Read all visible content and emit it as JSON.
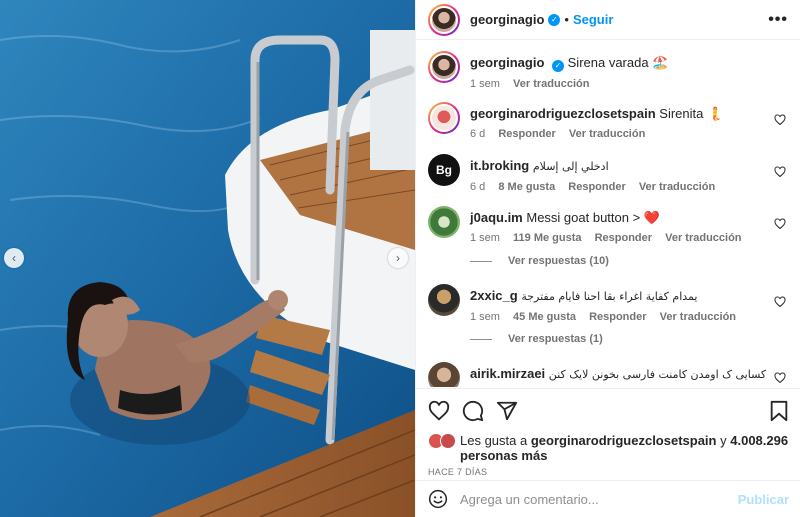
{
  "post": {
    "author": "georginagio",
    "follow_label": "Seguir",
    "dot": "•",
    "more_label": "•••",
    "caption": {
      "username": "georginagio",
      "text": "Sirena varada 🏖️",
      "time": "1 sem",
      "translate": "Ver traducción"
    }
  },
  "comments": [
    {
      "username": "georginarodriguezclosetspain",
      "text": "Sirenita 🧜",
      "time": "6 d",
      "likes": "",
      "reply": "Responder",
      "translate": "Ver traducción"
    },
    {
      "username": "it.broking",
      "text": "ادخلي إلى إسلام",
      "time": "6 d",
      "likes": "8 Me gusta",
      "reply": "Responder",
      "translate": "Ver traducción"
    },
    {
      "username": "j0aqu.im",
      "text": "Messi goat button > ❤️",
      "time": "1 sem",
      "likes": "119 Me gusta",
      "reply": "Responder",
      "translate": "Ver traducción",
      "replies": "Ver respuestas (10)"
    },
    {
      "username": "2xxic_g",
      "text": "يمدام كفاية اغراء بقا احنا فايام مفترجة",
      "time": "1 sem",
      "likes": "45 Me gusta",
      "reply": "Responder",
      "translate": "Ver traducción",
      "replies": "Ver respuestas (1)"
    },
    {
      "username": "airik.mirzaei",
      "text": "کسایی ک اومدن کامنت فارسی بخونن لایک کنن😂😂",
      "time": "",
      "likes": "",
      "reply": "",
      "translate": ""
    }
  ],
  "avatars": {
    "it_broking": "Bg"
  },
  "likes": {
    "prefix": "Les gusta a",
    "user": "georginarodriguezclosetspain",
    "mid": "y",
    "count": "4.008.296",
    "suffix": "personas más"
  },
  "timestamp": "HACE 7 DÍAS",
  "composer": {
    "placeholder": "Agrega un comentario...",
    "publish_label": "Publicar"
  },
  "icons": [
    "heart-icon",
    "comment-icon",
    "share-icon",
    "bookmark-icon",
    "emoji-icon",
    "verified-icon",
    "more-icon"
  ],
  "colors": {
    "accent": "#0095f6",
    "text": "#262626",
    "muted": "#737373",
    "publish_disabled": "#b2dffc"
  }
}
